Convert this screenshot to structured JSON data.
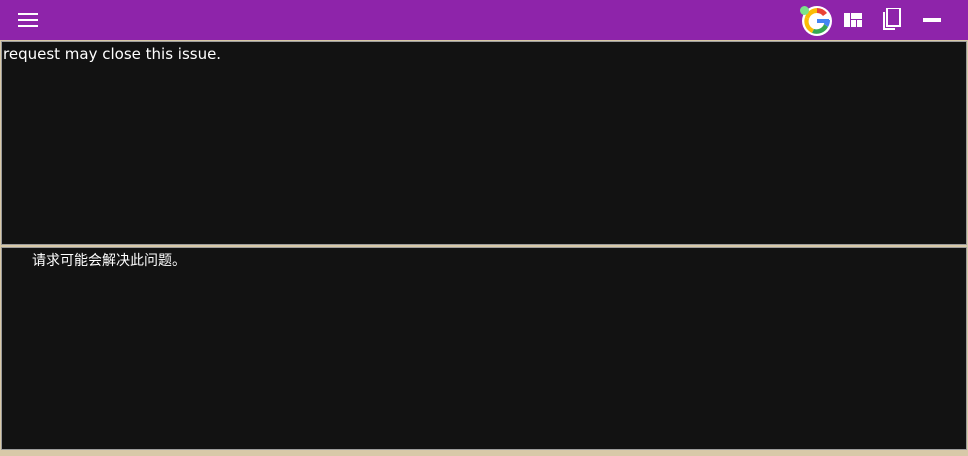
{
  "toolbar": {
    "background": "#8e24aa",
    "icons": {
      "menu": "hamburger-menu-icon",
      "google": "google-translate-icon",
      "layout": "layout-grid-icon",
      "copy": "copy-icon",
      "minimize": "minimize-icon"
    }
  },
  "source": {
    "text": "request may close this issue."
  },
  "translation": {
    "text": "请求可能会解决此问题。"
  },
  "colors": {
    "panel_bg": "#121212",
    "separator": "#d8c9a8",
    "google_blue": "#4285f4",
    "google_red": "#ea4335",
    "google_yellow": "#fbbc05",
    "google_green": "#34a853"
  }
}
